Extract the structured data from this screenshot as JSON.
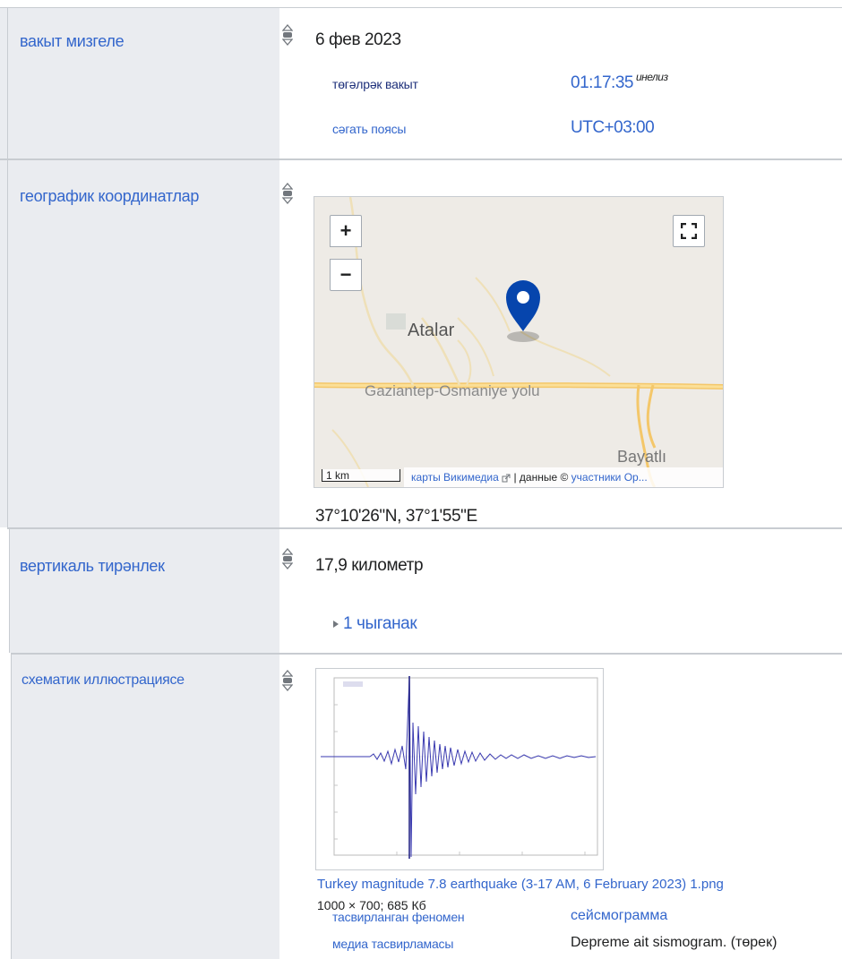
{
  "rows": {
    "point_in_time": {
      "label": "вакыт мизгеле",
      "value": "6 фев 2023",
      "qualifiers": [
        {
          "property": "төгәлрәк вакыт",
          "value": "01:17:35",
          "value_sup": "инелиз"
        },
        {
          "property": "сәгать поясы",
          "value": "UTC+03:00"
        }
      ]
    },
    "coordinates": {
      "label": "географик координатлар",
      "map": {
        "zoom_in": "+",
        "zoom_out": "−",
        "place_labels": [
          "Atalar",
          "Gaziantep-Osmaniye yolu",
          "Bayatlı"
        ],
        "scale_label": "1 km",
        "attribution_link1": "карты Викимедиа",
        "attribution_text": "| данные ©",
        "attribution_link2": "участники Ор..."
      },
      "value": "37°10'26\"N, 37°1'55\"E"
    },
    "depth": {
      "label": "вертикаль тирәнлек",
      "value": "17,9 километр",
      "references": "1 чыганак"
    },
    "schematic": {
      "label": "схематик иллюстрациясе",
      "file_name": "Turkey magnitude 7.8 earthquake (3-17 AM, 6 February 2023) 1.png",
      "file_info": "1000 × 700; 685 Кб",
      "qualifiers": [
        {
          "property": "тасвирланган феномен",
          "value": "сейсмограмма"
        },
        {
          "property": "медиа тасвирламасы",
          "value": "Depreme ait sismogram. (төрек)"
        }
      ]
    }
  },
  "colors": {
    "link": "#3366cc",
    "property_bg": "#eaecf0",
    "marker": "#0645ad"
  }
}
